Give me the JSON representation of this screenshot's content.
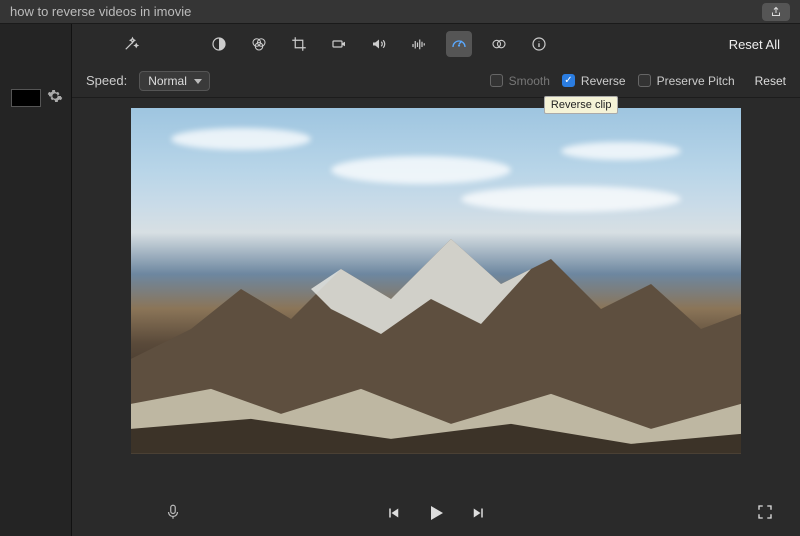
{
  "window": {
    "title": "how to reverse videos in imovie"
  },
  "toolbar": {
    "reset_all_label": "Reset All"
  },
  "speed_panel": {
    "speed_label": "Speed:",
    "speed_value": "Normal",
    "smooth_label": "Smooth",
    "smooth_checked": false,
    "reverse_label": "Reverse",
    "reverse_checked": true,
    "preserve_pitch_label": "Preserve Pitch",
    "preserve_pitch_checked": false,
    "reset_label": "Reset",
    "tooltip": "Reverse clip"
  }
}
